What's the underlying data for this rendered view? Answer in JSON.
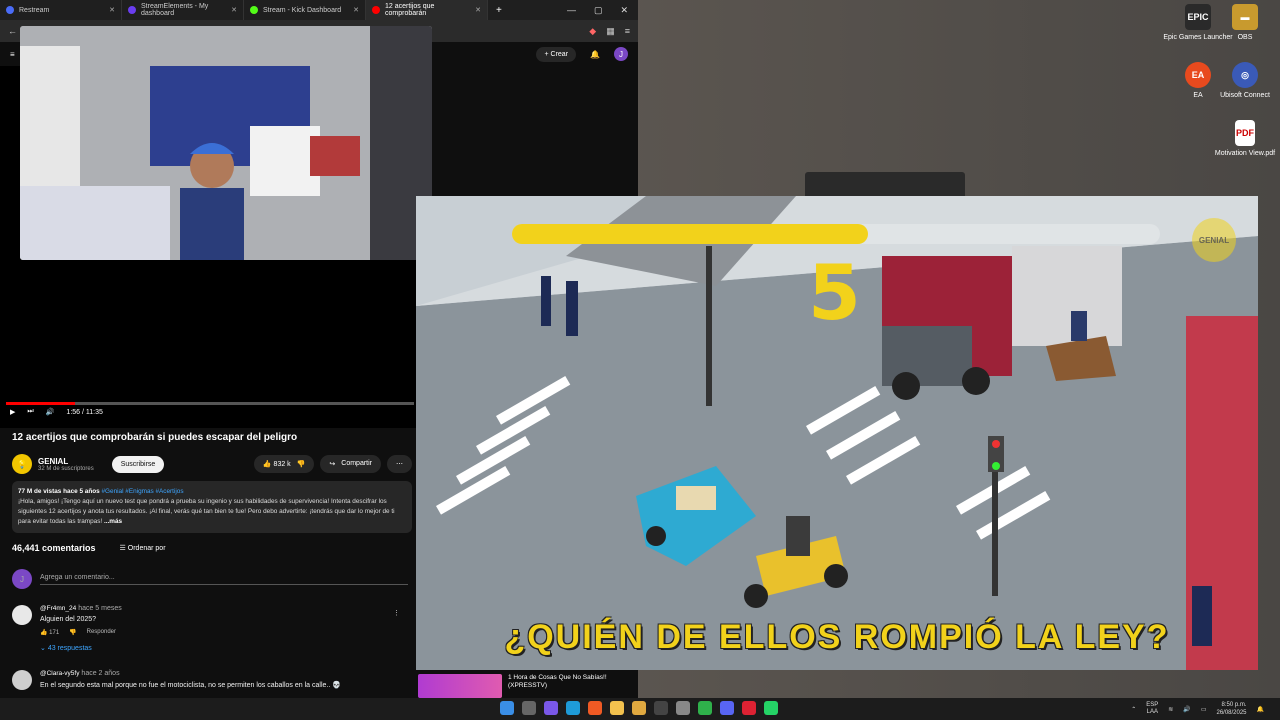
{
  "desktop": {
    "icons": [
      {
        "label": "Epic Games Launcher",
        "glyph": "EPIC",
        "color": "#2a2a2a"
      },
      {
        "label": "OBS",
        "glyph": "▬",
        "color": "#c89a2e"
      },
      {
        "label": "EA",
        "glyph": "EA",
        "color": "#e84a1e"
      },
      {
        "label": "Ubisoft Connect",
        "glyph": "◎",
        "color": "#3a5ab8"
      },
      {
        "label": "Motivation View.pdf",
        "glyph": "PDF",
        "color": "#ffffff"
      }
    ]
  },
  "browser": {
    "tabs": [
      {
        "label": "Restream",
        "color": "#4a6cf7"
      },
      {
        "label": "StreamElements - My dashboard",
        "color": "#6a3df0"
      },
      {
        "label": "Stream - Kick Dashboard",
        "color": "#53fc18"
      },
      {
        "label": "12 acertijos que comprobarán",
        "color": "#ff0000"
      }
    ],
    "window_controls": {
      "minimize": "—",
      "maximize": "▢",
      "close": "✕"
    }
  },
  "youtube": {
    "create_label": "Crear",
    "user_initial": "J",
    "player": {
      "time": "1:56 / 11:35",
      "progress": 0.168
    },
    "video": {
      "title": "12 acertijos que comprobarán si puedes escapar del peligro",
      "channel": "GENIAL",
      "subscribers": "32 M de suscriptores",
      "subscribe_label": "Suscribirse",
      "likes": "832 k",
      "share_label": "Compartir"
    },
    "description": {
      "views_date": "77 M de vistas  hace 5 años",
      "tags": "#Genial #Enigmas #Acertijos",
      "text": "¡Hola, amigos! ¡Tengo aquí un nuevo test que pondrá a prueba su ingenio y sus habilidades de supervivencia! Intenta descifrar los siguientes 12 acertijos y anota tus resultados. ¡Al final, verás qué tan bien te fue! Pero debo advertirte: ¡tendrás que dar lo mejor de ti para evitar todas las trampas!",
      "more": "...más"
    },
    "comments": {
      "count": "46,441 comentarios",
      "sort_label": "Ordenar por",
      "add_placeholder": "Agrega un comentario...",
      "items": [
        {
          "author": "@Fr4mn_24",
          "ago": "hace 5 meses",
          "text": "Alguien del 2025?",
          "likes": "171",
          "reply_label": "Responder",
          "replies": "43 respuestas"
        },
        {
          "author": "@Clara-vy5fy",
          "ago": "hace 2 años",
          "text": "En el segundo esta mal porque no fue el motociclista, no se permiten los caballos en la  calle.. 💀"
        }
      ]
    },
    "recommended": {
      "title": "1 Hora de Cosas Que No Sabías!! (XPRESSTV)"
    }
  },
  "game": {
    "countdown": "5",
    "timer_remaining": 0.55,
    "logo": "GENIAL",
    "question": "¿QUIÉN DE ELLOS ROMPIÓ LA LEY?"
  },
  "taskbar": {
    "language": "ESP",
    "layout": "LAA",
    "time": "8:50 p.m.",
    "date": "26/08/2025"
  }
}
